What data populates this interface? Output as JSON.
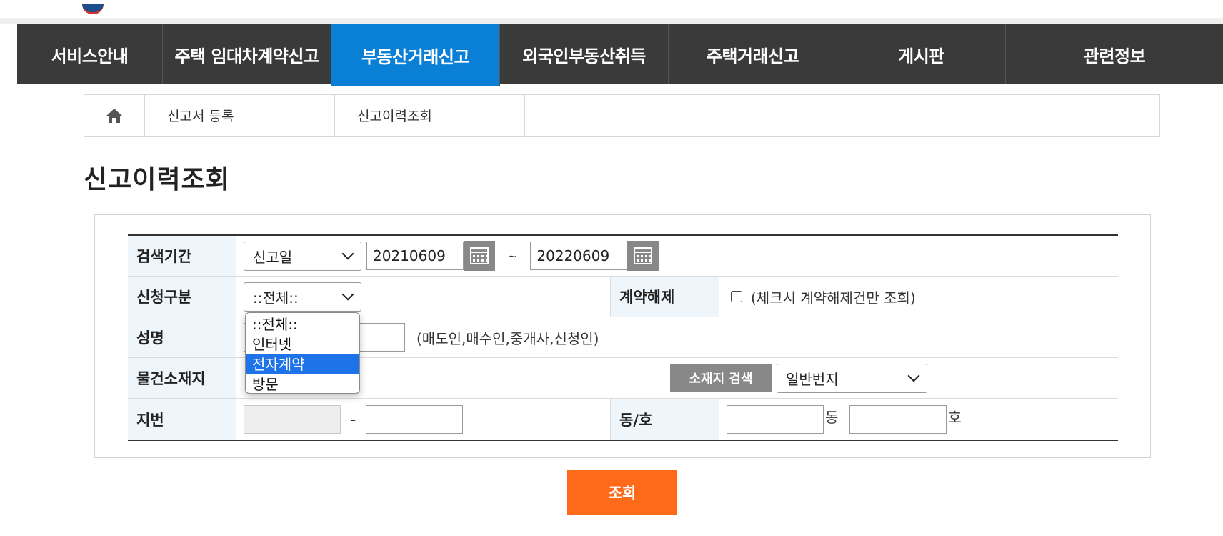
{
  "nav": {
    "items": [
      {
        "label": "서비스안내"
      },
      {
        "label": "주택 임대차계약신고"
      },
      {
        "label": "부동산거래신고",
        "active": true
      },
      {
        "label": "외국인부동산취득"
      },
      {
        "label": "주택거래신고"
      },
      {
        "label": "게시판"
      },
      {
        "label": "관련정보"
      }
    ],
    "active_color": "#0a7fd6",
    "bg_color": "#3a3a3a"
  },
  "breadcrumb": {
    "home_icon": "home-icon",
    "items": [
      "신고서 등록",
      "신고이력조회"
    ]
  },
  "page_title": "신고이력조회",
  "form": {
    "period": {
      "label": "검색기간",
      "type_value": "신고일",
      "from": "20210609",
      "sep": "~",
      "to": "20220609",
      "calendar_icon": "calendar-icon"
    },
    "category": {
      "label": "신청구분",
      "value": "::전체::",
      "options": [
        "::전체::",
        "인터넷",
        "전자계약",
        "방문"
      ],
      "highlighted": "전자계약"
    },
    "cancel": {
      "label": "계약해제",
      "hint": "(체크시 계약해제건만 조회)"
    },
    "name": {
      "label": "성명",
      "hint": "(매도인,매수인,중개사,신청인)"
    },
    "location": {
      "label": "물건소재지",
      "search_button": "소재지 검색",
      "lot_type": "일반번지"
    },
    "lot": {
      "label": "지번",
      "sep": "-"
    },
    "unit": {
      "label": "동/호",
      "dong_suffix": "동",
      "ho_suffix": "호"
    }
  },
  "search_button": "조회",
  "accent_color": "#ff6a1a"
}
